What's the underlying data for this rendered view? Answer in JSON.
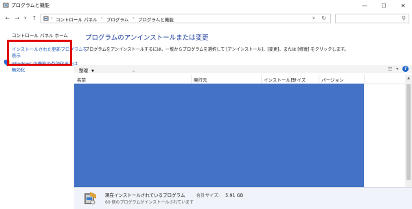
{
  "window": {
    "title": "プログラムと機能"
  },
  "address": {
    "crumbs": [
      "コントロール パネル",
      "プログラム",
      "プログラムと機能"
    ]
  },
  "left_pane": {
    "home": "コントロール パネル ホーム",
    "updates_line1": "インストールされた更新プログラムを",
    "updates_line2": "表示",
    "features_line1": "Windows の機能の有効化または",
    "features_line2": "無効化"
  },
  "main": {
    "heading": "プログラムのアンインストールまたは変更",
    "description": "プログラムをアンインストールするには、一覧からプログラムを選択して [アンインストール]、[変更]、または [修復] をクリックします。"
  },
  "toolbar": {
    "organize": "整理"
  },
  "columns": [
    "名前",
    "発行元",
    "インストール日",
    "サイズ",
    "バージョン"
  ],
  "details": {
    "title": "現在インストールされているプログラム",
    "size_label": "合計サイズ:",
    "size_value": "5.91 GB",
    "count_text": "60 個のプログラムがインストールされています"
  },
  "colors": {
    "list_fill": "#4472c4",
    "highlight": "#e00000",
    "link": "#1a56b8"
  }
}
